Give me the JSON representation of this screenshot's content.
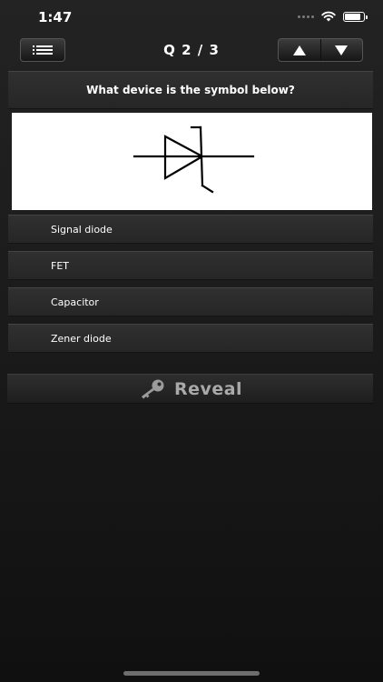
{
  "status_bar": {
    "time": "1:47",
    "battery_level": 0.85
  },
  "nav": {
    "title": "Q 2 / 3",
    "menu_icon": "list-icon",
    "prev_icon": "up-triangle-icon",
    "next_icon": "down-triangle-icon"
  },
  "question": {
    "text": "What device is the symbol below?",
    "symbol": "zener-diode-symbol"
  },
  "answers": [
    {
      "label": "Signal diode"
    },
    {
      "label": "FET"
    },
    {
      "label": "Capacitor"
    },
    {
      "label": "Zener diode"
    }
  ],
  "reveal": {
    "label": "Reveal",
    "icon": "key-icon"
  },
  "colors": {
    "background": "#1b1b1b",
    "panel": "#2b2b2b",
    "reveal_text": "#a9a9a9"
  }
}
